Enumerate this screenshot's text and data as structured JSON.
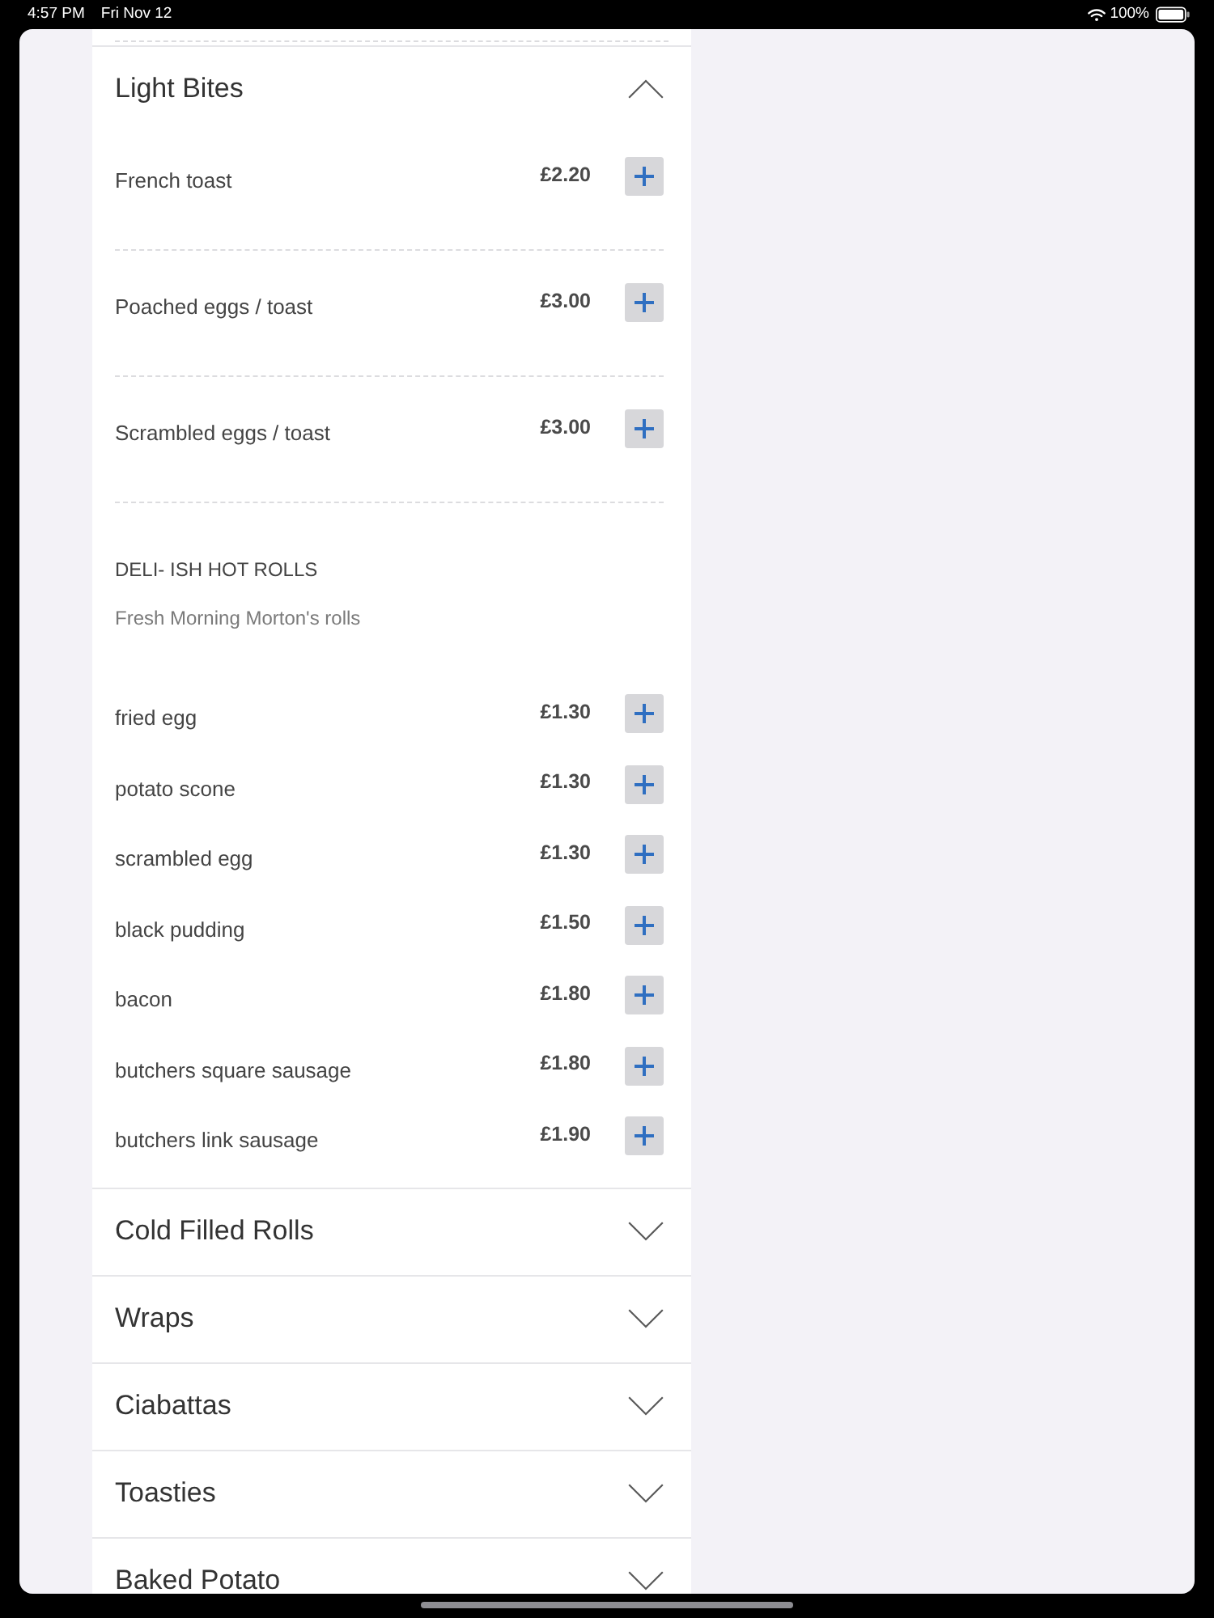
{
  "status_bar": {
    "time": "4:57 PM",
    "date": "Fri Nov 12",
    "battery": "100%"
  },
  "sections": [
    {
      "title": "Light Bites",
      "expanded": true,
      "groups": [
        {
          "kind": "spaced",
          "items": [
            {
              "name": "French toast",
              "price": "£2.20"
            },
            {
              "name": "Poached eggs / toast",
              "price": "£3.00"
            },
            {
              "name": "Scrambled eggs / toast",
              "price": "£3.00"
            }
          ]
        },
        {
          "kind": "compact",
          "heading": "DELI- ISH HOT ROLLS",
          "description": "Fresh Morning Morton's rolls",
          "items": [
            {
              "name": "fried egg",
              "price": "£1.30"
            },
            {
              "name": "potato scone",
              "price": "£1.30"
            },
            {
              "name": "scrambled egg",
              "price": "£1.30"
            },
            {
              "name": "black pudding",
              "price": "£1.50"
            },
            {
              "name": "bacon",
              "price": "£1.80"
            },
            {
              "name": "butchers square sausage",
              "price": "£1.80"
            },
            {
              "name": "butchers link sausage",
              "price": "£1.90"
            }
          ]
        }
      ]
    },
    {
      "title": "Cold Filled Rolls",
      "expanded": false
    },
    {
      "title": "Wraps",
      "expanded": false
    },
    {
      "title": "Ciabattas",
      "expanded": false
    },
    {
      "title": "Toasties",
      "expanded": false
    },
    {
      "title": "Baked Potato",
      "expanded": false
    }
  ]
}
